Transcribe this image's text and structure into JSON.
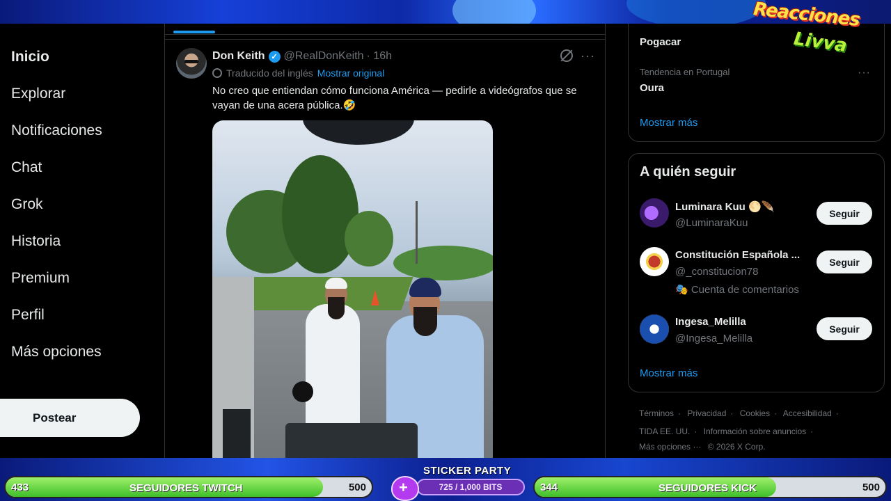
{
  "overlay": {
    "logo_line1": "Reacciones",
    "logo_line2": "Livva",
    "twitch_goal": {
      "current": "433",
      "label": "SEGUIDORES TWITCH",
      "max": "500",
      "progress": 0.866
    },
    "kick_goal": {
      "current": "344",
      "label": "SEGUIDORES KICK",
      "max": "500",
      "progress": 0.688
    },
    "sticker": {
      "title": "STICKER PARTY",
      "bits": "725 / 1,000 BITS",
      "progress": 0.725,
      "icon": "plus-heart-icon"
    }
  },
  "nav": {
    "items": [
      {
        "label": "Inicio",
        "active": true
      },
      {
        "label": "Explorar"
      },
      {
        "label": "Notificaciones"
      },
      {
        "label": "Chat"
      },
      {
        "label": "Grok"
      },
      {
        "label": "Historia"
      },
      {
        "label": "Premium"
      },
      {
        "label": "Perfil"
      },
      {
        "label": "Más opciones"
      }
    ],
    "post_button": "Postear"
  },
  "tweet": {
    "author_name": "Don Keith",
    "handle": "@RealDonKeith",
    "time": "· 16h",
    "translated_label": "Traducido del inglés",
    "show_original": "Mostrar original",
    "text": "No creo que entiendan cómo funciona América — pedirle a videógrafos que se vayan de una acera pública.🤣",
    "more_icon": "more-horizontal-icon",
    "verified_color": "#1d9bf0"
  },
  "trends": {
    "items": [
      {
        "meta": "",
        "title": "Pogacar"
      },
      {
        "meta": "Tendencia en Portugal",
        "title": "Oura"
      }
    ],
    "show_more": "Mostrar más"
  },
  "who_to_follow": {
    "title": "A quién seguir",
    "suggestions": [
      {
        "name": "Luminara Kuu 🌕🪶",
        "handle": "@LuminaraKuu",
        "extra": "",
        "button": "Seguir"
      },
      {
        "name": "Constitución Española ...",
        "handle": "@_constitucion78",
        "extra": "🎭 Cuenta de comentarios",
        "button": "Seguir"
      },
      {
        "name": "Ingesa_Melilla",
        "handle": "@Ingesa_Melilla",
        "extra": "",
        "button": "Seguir"
      }
    ],
    "show_more": "Mostrar más"
  },
  "footer": {
    "row1": [
      "Términos",
      "Privacidad",
      "Cookies",
      "Accesibilidad"
    ],
    "row2": [
      "TIDA EE. UU.",
      "Información sobre anuncios"
    ],
    "row3": [
      "Más opciones ···",
      "© 2026 X Corp."
    ]
  },
  "colors": {
    "accent": "#1d9bf0",
    "background": "#000000",
    "goal_green": "#3fbf2a",
    "sticker_purple": "#b43af0"
  }
}
